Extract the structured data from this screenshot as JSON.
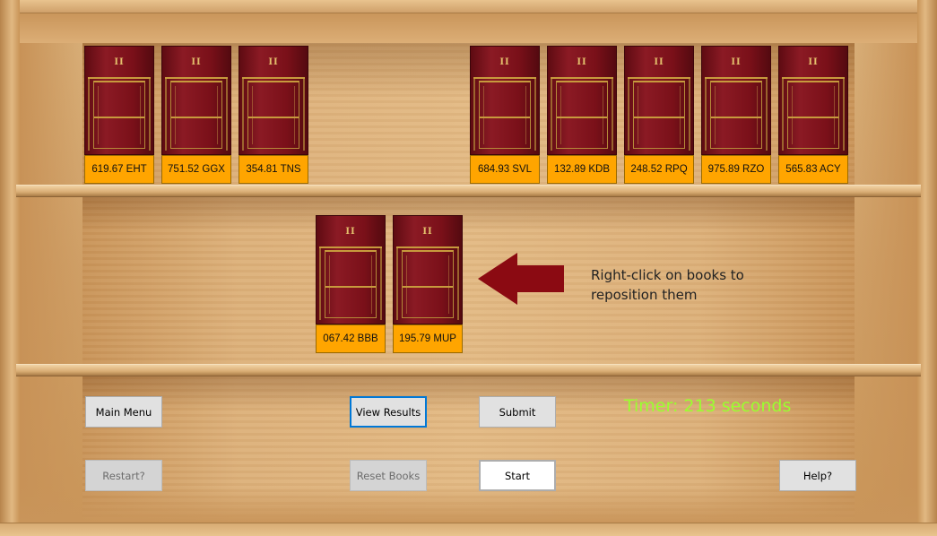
{
  "shelf_top": {
    "books": [
      {
        "label": "619.67 EHT",
        "numeral": "II"
      },
      {
        "label": "751.52 GGX",
        "numeral": "II"
      },
      {
        "label": "354.81 TNS",
        "numeral": "II"
      },
      {
        "label": "684.93 SVL",
        "numeral": "II"
      },
      {
        "label": "132.89 KDB",
        "numeral": "II"
      },
      {
        "label": "248.52 RPQ",
        "numeral": "II"
      },
      {
        "label": "975.89 RZO",
        "numeral": "II"
      },
      {
        "label": "565.83 ACY",
        "numeral": "II"
      }
    ]
  },
  "shelf_middle": {
    "books": [
      {
        "label": "067.42 BBB",
        "numeral": "II"
      },
      {
        "label": "195.79 MUP",
        "numeral": "II"
      }
    ]
  },
  "instruction": {
    "text": "Right-click on books to reposition them",
    "arrow_color": "#8b0a12"
  },
  "buttons": {
    "main_menu": "Main Menu",
    "view_results": "View Results",
    "submit": "Submit",
    "restart": "Restart?",
    "reset_books": "Reset Books",
    "start": "Start",
    "help": "Help?"
  },
  "timer": {
    "text": "Timer: 213 seconds",
    "color": "#9aff2f"
  },
  "colors": {
    "book_label": "#ffa500",
    "book_cover": "#7a1019",
    "focus_border": "#0078d7"
  }
}
